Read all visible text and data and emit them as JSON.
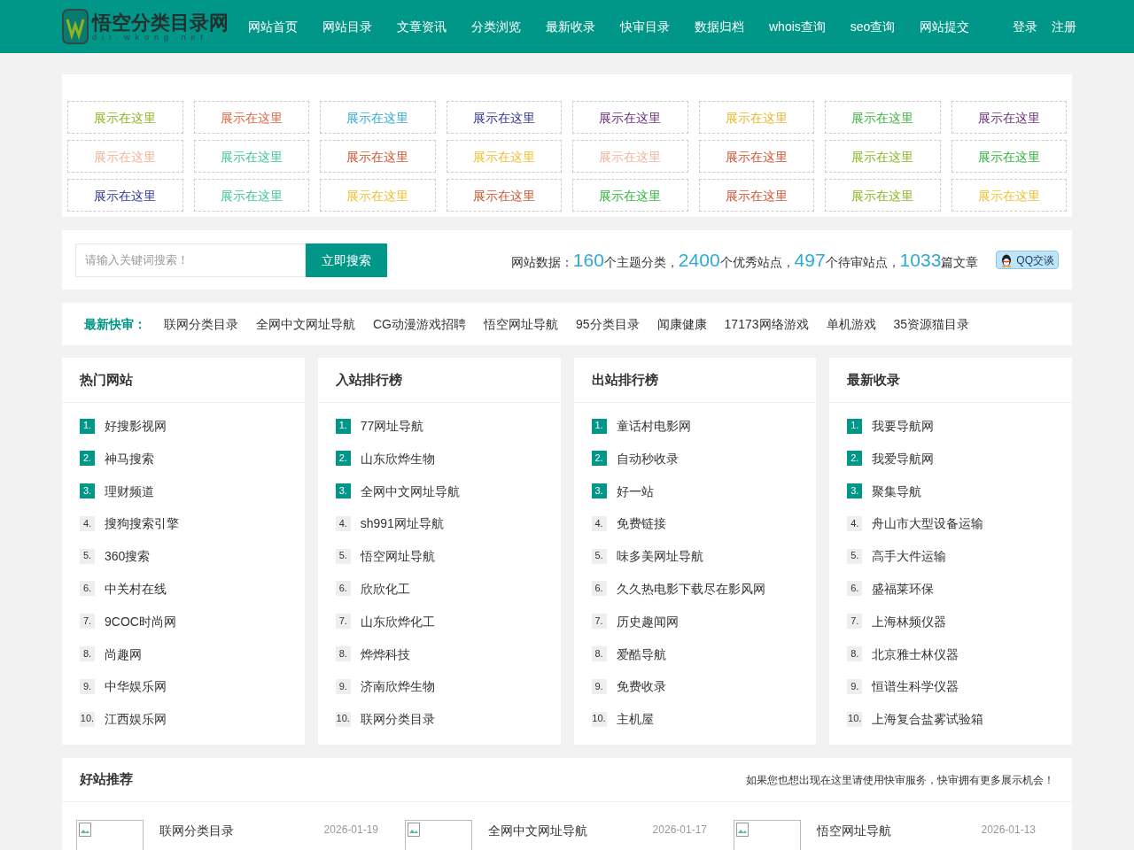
{
  "header": {
    "logo": {
      "title": "悟空分类目录网",
      "subtitle": "dir.wkong.net"
    },
    "nav": [
      {
        "label": "网站首页"
      },
      {
        "label": "网站目录"
      },
      {
        "label": "文章资讯"
      },
      {
        "label": "分类浏览"
      },
      {
        "label": "最新收录"
      },
      {
        "label": "快审目录"
      },
      {
        "label": "数据归档"
      },
      {
        "label": "whois查询"
      },
      {
        "label": "seo查询"
      },
      {
        "label": "网站提交"
      }
    ],
    "account": [
      {
        "label": "登录"
      },
      {
        "label": "注册"
      }
    ]
  },
  "ads": [
    {
      "label": "展示在这里",
      "color": "#8cb520"
    },
    {
      "label": "展示在这里",
      "color": "#e2623b"
    },
    {
      "label": "展示在这里",
      "color": "#2ea9d6"
    },
    {
      "label": "展示在这里",
      "color": "#2b3595"
    },
    {
      "label": "展示在这里",
      "color": "#6b2d7a"
    },
    {
      "label": "展示在这里",
      "color": "#e8b92a"
    },
    {
      "label": "展示在这里",
      "color": "#3bb33b"
    },
    {
      "label": "展示在这里",
      "color": "#6b2d7a"
    },
    {
      "label": "展示在这里",
      "color": "#f0b49a"
    },
    {
      "label": "展示在这里",
      "color": "#3cc69a"
    },
    {
      "label": "展示在这里",
      "color": "#d2522e"
    },
    {
      "label": "展示在这里",
      "color": "#f0c030"
    },
    {
      "label": "展示在这里",
      "color": "#f0b49a"
    },
    {
      "label": "展示在这里",
      "color": "#d2522e"
    },
    {
      "label": "展示在这里",
      "color": "#8cb520"
    },
    {
      "label": "展示在这里",
      "color": "#2fb43c"
    },
    {
      "label": "展示在这里",
      "color": "#2b3595"
    },
    {
      "label": "展示在这里",
      "color": "#3cc69a"
    },
    {
      "label": "展示在这里",
      "color": "#f0c030"
    },
    {
      "label": "展示在这里",
      "color": "#d2522e"
    },
    {
      "label": "展示在这里",
      "color": "#2fb43c"
    },
    {
      "label": "展示在这里",
      "color": "#d2522e"
    },
    {
      "label": "展示在这里",
      "color": "#8cb520"
    },
    {
      "label": "展示在这里",
      "color": "#f0c030"
    }
  ],
  "search": {
    "placeholder": "请输入关键词搜索！",
    "button": "立即搜索"
  },
  "stats": {
    "label": "网站数据：",
    "items": [
      {
        "number": "160",
        "unit": "个主题分类，"
      },
      {
        "number": "2400",
        "unit": "个优秀站点，"
      },
      {
        "number": "497",
        "unit": "个待审站点，"
      },
      {
        "number": "1033",
        "unit": "篇文章"
      }
    ],
    "qq_button": "QQ交谈"
  },
  "quick": {
    "label": "最新快审：",
    "links": [
      "联网分类目录",
      "全网中文网址导航",
      "CG动漫游戏招聘",
      "悟空网址导航",
      "95分类目录",
      "闻康健康",
      "17173网络游戏",
      "单机游戏",
      "35资源猫目录"
    ]
  },
  "rankings": [
    {
      "title": "热门网站",
      "items": [
        {
          "rank": "1.",
          "name": "好搜影视网",
          "highlighted": true
        },
        {
          "rank": "2.",
          "name": "神马搜索",
          "highlighted": true
        },
        {
          "rank": "3.",
          "name": "理财频道",
          "highlighted": true
        },
        {
          "rank": "4.",
          "name": "搜狗搜索引擎",
          "highlighted": false
        },
        {
          "rank": "5.",
          "name": "360搜索",
          "highlighted": false
        },
        {
          "rank": "6.",
          "name": "中关村在线",
          "highlighted": false
        },
        {
          "rank": "7.",
          "name": "9COC时尚网",
          "highlighted": false
        },
        {
          "rank": "8.",
          "name": "尚趣网",
          "highlighted": false
        },
        {
          "rank": "9.",
          "name": "中华娱乐网",
          "highlighted": false
        },
        {
          "rank": "10.",
          "name": "江西娱乐网",
          "highlighted": false
        }
      ]
    },
    {
      "title": "入站排行榜",
      "items": [
        {
          "rank": "1.",
          "name": "77网址导航",
          "highlighted": true
        },
        {
          "rank": "2.",
          "name": "山东欣烨生物",
          "highlighted": true
        },
        {
          "rank": "3.",
          "name": "全网中文网址导航",
          "highlighted": true
        },
        {
          "rank": "4.",
          "name": "sh991网址导航",
          "highlighted": false
        },
        {
          "rank": "5.",
          "name": "悟空网址导航",
          "highlighted": false
        },
        {
          "rank": "6.",
          "name": "欣欣化工",
          "highlighted": false
        },
        {
          "rank": "7.",
          "name": "山东欣烨化工",
          "highlighted": false
        },
        {
          "rank": "8.",
          "name": "烨烨科技",
          "highlighted": false
        },
        {
          "rank": "9.",
          "name": "济南欣烨生物",
          "highlighted": false
        },
        {
          "rank": "10.",
          "name": "联网分类目录",
          "highlighted": false
        }
      ]
    },
    {
      "title": "出站排行榜",
      "items": [
        {
          "rank": "1.",
          "name": "童话村电影网",
          "highlighted": true
        },
        {
          "rank": "2.",
          "name": "自动秒收录",
          "highlighted": true
        },
        {
          "rank": "3.",
          "name": "好一站",
          "highlighted": true
        },
        {
          "rank": "4.",
          "name": "免费链接",
          "highlighted": false
        },
        {
          "rank": "5.",
          "name": "味多美网址导航",
          "highlighted": false
        },
        {
          "rank": "6.",
          "name": "久久热电影下载尽在影风网",
          "highlighted": false
        },
        {
          "rank": "7.",
          "name": "历史趣闻网",
          "highlighted": false
        },
        {
          "rank": "8.",
          "name": "爱酷导航",
          "highlighted": false
        },
        {
          "rank": "9.",
          "name": "免费收录",
          "highlighted": false
        },
        {
          "rank": "10.",
          "name": "主机屋",
          "highlighted": false
        }
      ]
    },
    {
      "title": "最新收录",
      "items": [
        {
          "rank": "1.",
          "name": "我要导航网",
          "highlighted": true
        },
        {
          "rank": "2.",
          "name": "我爱导航网",
          "highlighted": true
        },
        {
          "rank": "3.",
          "name": "聚集导航",
          "highlighted": true
        },
        {
          "rank": "4.",
          "name": "舟山市大型设备运输",
          "highlighted": false
        },
        {
          "rank": "5.",
          "name": "高手大件运输",
          "highlighted": false
        },
        {
          "rank": "6.",
          "name": "盛福莱环保",
          "highlighted": false
        },
        {
          "rank": "7.",
          "name": "上海林频仪器",
          "highlighted": false
        },
        {
          "rank": "8.",
          "name": "北京雅士林仪器",
          "highlighted": false
        },
        {
          "rank": "9.",
          "name": "恒谱生科学仪器",
          "highlighted": false
        },
        {
          "rank": "10.",
          "name": "上海复合盐雾试验箱",
          "highlighted": false
        }
      ]
    }
  ],
  "recommend": {
    "title": "好站推荐",
    "notice": "如果您也想出现在这里请使用快审服务，快审拥有更多展示机会！",
    "sites": [
      {
        "name": "联网分类目录",
        "date": "2026-01-19"
      },
      {
        "name": "全网中文网址导航",
        "date": "2026-01-17"
      },
      {
        "name": "悟空网址导航",
        "date": "2026-01-13"
      }
    ]
  }
}
